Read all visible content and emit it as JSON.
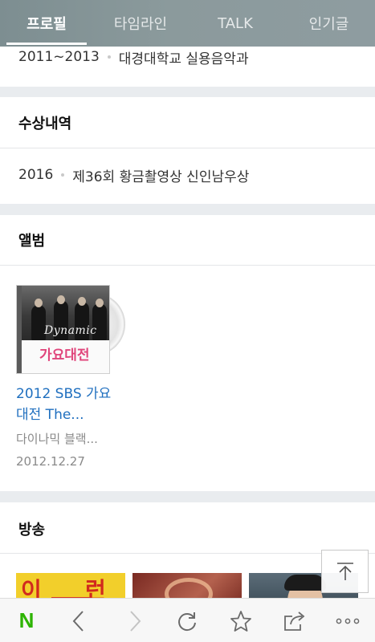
{
  "tabs": [
    {
      "label": "프로필",
      "active": true
    },
    {
      "label": "타임라인",
      "active": false
    },
    {
      "label": "TALK",
      "active": false
    },
    {
      "label": "인기글",
      "active": false
    }
  ],
  "education": {
    "period": "2011~2013",
    "school": "대경대학교 실용음악과"
  },
  "awards": {
    "title": "수상내역",
    "items": [
      {
        "year": "2016",
        "name": "제36회 황금촬영상 신인남우상"
      }
    ]
  },
  "albums": {
    "title": "앨범",
    "items": [
      {
        "name": "2012 SBS 가요대전 The...",
        "artist": "다이나믹 블랙...",
        "date": "2012.12.27",
        "cover_script": "Dynamic",
        "cover_logo": "가요대전"
      }
    ]
  },
  "broadcast": {
    "title": "방송",
    "thumb1_text_a": "이",
    "thumb1_text_b": "런"
  },
  "bottombar": {
    "naver_logo": "N"
  },
  "colors": {
    "accent_link": "#1f6fbf",
    "naver_green": "#2db400",
    "tab_active": "#ffffff"
  }
}
